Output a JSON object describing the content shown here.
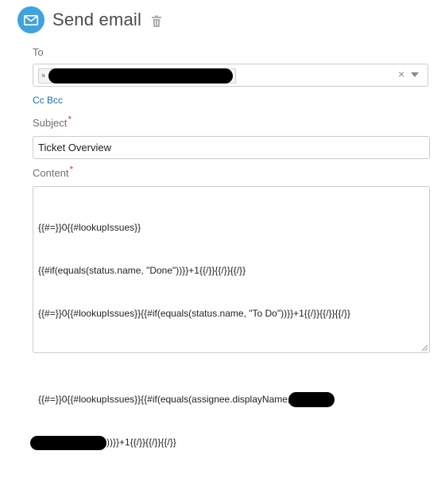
{
  "header": {
    "title": "Send email",
    "icon": "envelope-icon",
    "delete_icon": "trash-icon",
    "accent_color": "#3fa3dd"
  },
  "to": {
    "label": "To",
    "chip_remove": "×",
    "clear": "×"
  },
  "cc_bcc": {
    "cc": "Cc",
    "bcc": "Bcc"
  },
  "subject": {
    "label": "Subject",
    "required_mark": "*",
    "value": "Ticket Overview"
  },
  "content": {
    "label": "Content",
    "required_mark": "*",
    "line1": "{{#=}}0{{#lookupIssues}}",
    "line2": "{{#if(equals(status.name, \"Done\"))}}+1{{/}}{{/}}{{/}}",
    "line3": "{{#=}}0{{#lookupIssues}}{{#if(equals(status.name, \"To Do\"))}}+1{{/}}{{/}}{{/}}",
    "line5_a": "{{#=}}0{{#lookupIssues}}{{#if(equals(assignee.displayName, ",
    "line6_b": "))}}+1{{/}}{{/}}{{/}}"
  }
}
